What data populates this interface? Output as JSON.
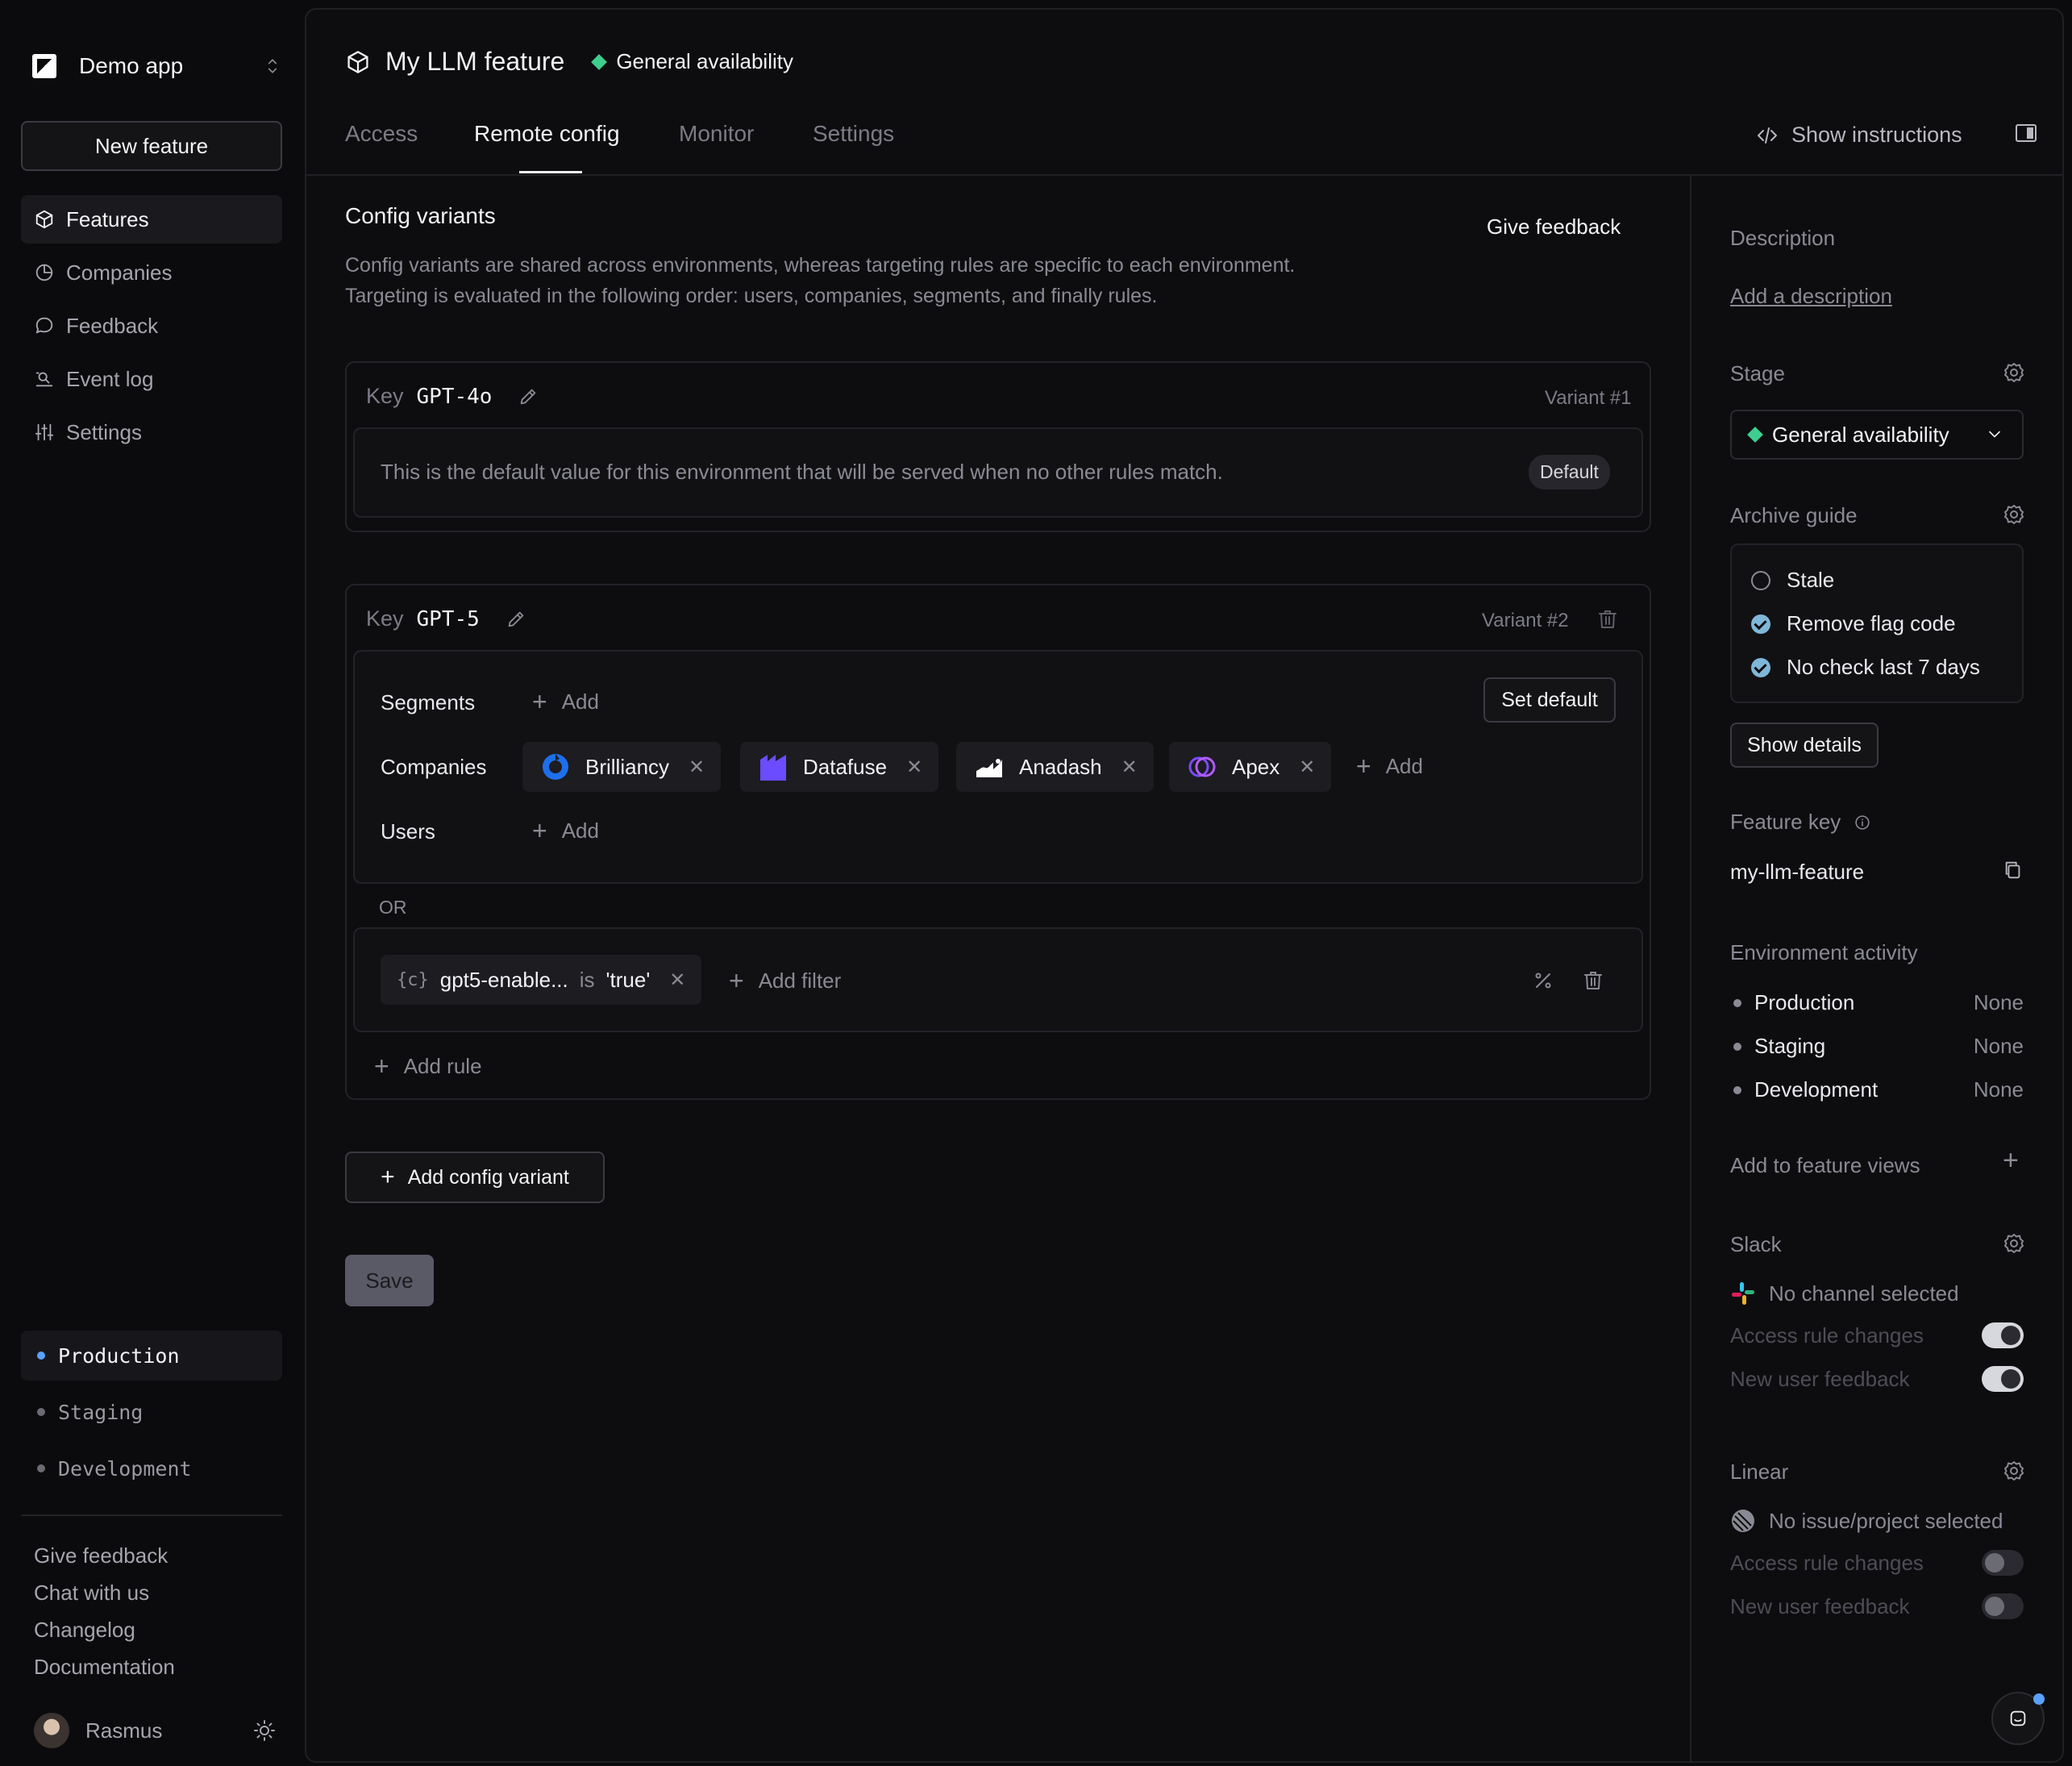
{
  "sidebar": {
    "app_name": "Demo app",
    "new_feature": "New feature",
    "nav": [
      {
        "label": "Features"
      },
      {
        "label": "Companies"
      },
      {
        "label": "Feedback"
      },
      {
        "label": "Event log"
      },
      {
        "label": "Settings"
      }
    ],
    "environments": [
      {
        "label": "Production",
        "active": true
      },
      {
        "label": "Staging"
      },
      {
        "label": "Development"
      }
    ],
    "footer_links": [
      "Give feedback",
      "Chat with us",
      "Changelog",
      "Documentation"
    ],
    "user_name": "Rasmus"
  },
  "header": {
    "feature_title": "My LLM feature",
    "stage": "General availability",
    "tabs": [
      "Access",
      "Remote config",
      "Monitor",
      "Settings"
    ],
    "active_tab": "Remote config",
    "show_instructions": "Show instructions"
  },
  "config": {
    "title": "Config variants",
    "give_feedback": "Give feedback",
    "description_1": "Config variants are shared across environments, whereas targeting rules are specific to each environment.",
    "description_2": "Targeting is evaluated in the following order: users, companies, segments, and finally rules.",
    "key_label": "Key",
    "variant1": {
      "key": "GPT-4o",
      "number": "Variant #1",
      "default_text": "This is the default value for this environment that will be served when no other rules match.",
      "default_badge": "Default"
    },
    "variant2": {
      "key": "GPT-5",
      "number": "Variant #2",
      "segments_label": "Segments",
      "companies_label": "Companies",
      "users_label": "Users",
      "add_label": "Add",
      "set_default": "Set default",
      "companies": [
        "Brilliancy",
        "Datafuse",
        "Anadash",
        "Apex"
      ],
      "or_label": "OR",
      "filter": {
        "icon_text": "{c}",
        "field": "gpt5-enable...",
        "op": "is",
        "value": "'true'"
      },
      "add_filter": "Add filter",
      "add_rule": "Add rule"
    },
    "add_variant": "Add config variant",
    "save": "Save"
  },
  "right_panel": {
    "description_label": "Description",
    "add_description": "Add a description",
    "stage_label": "Stage",
    "stage_value": "General availability",
    "archive_label": "Archive guide",
    "archive_items": [
      {
        "label": "Stale",
        "done": false
      },
      {
        "label": "Remove flag code",
        "done": true
      },
      {
        "label": "No check last 7 days",
        "done": true
      }
    ],
    "show_details": "Show details",
    "feature_key_label": "Feature key",
    "feature_key": "my-llm-feature",
    "env_activity_label": "Environment activity",
    "env_activity": [
      {
        "name": "Production",
        "status": "None"
      },
      {
        "name": "Staging",
        "status": "None"
      },
      {
        "name": "Development",
        "status": "None"
      }
    ],
    "add_to_views": "Add to feature views",
    "slack_label": "Slack",
    "slack_channel": "No channel selected",
    "access_rule_changes": "Access rule changes",
    "new_user_feedback": "New user feedback",
    "linear_label": "Linear",
    "linear_project": "No issue/project selected"
  }
}
